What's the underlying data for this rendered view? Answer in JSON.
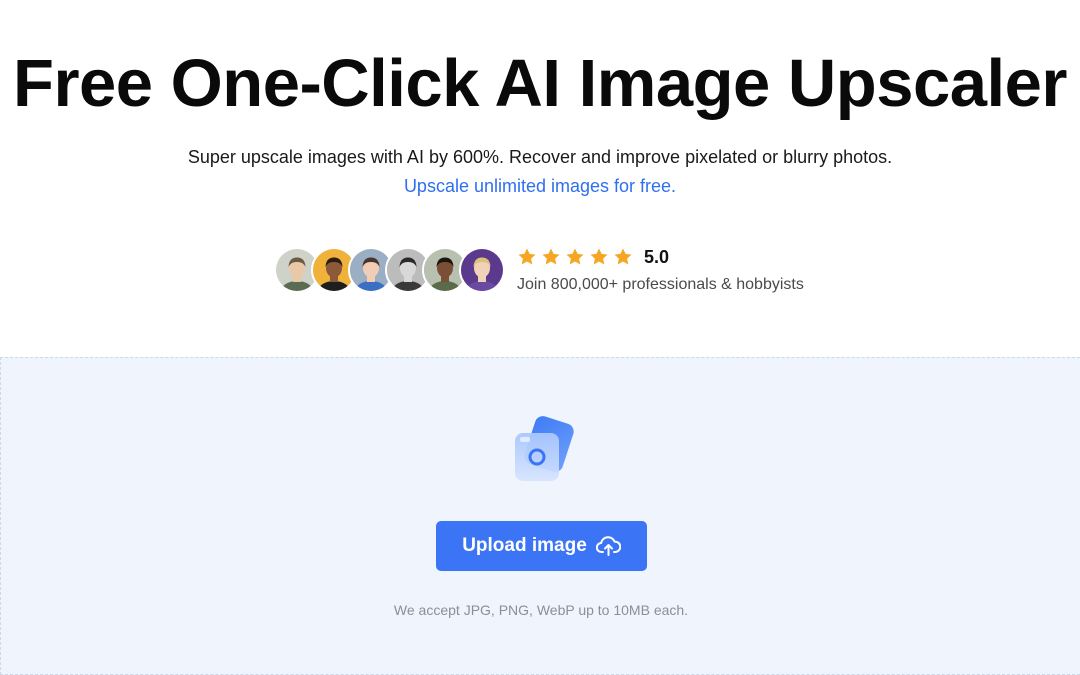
{
  "hero": {
    "title": "Free One-Click AI Image Upscaler",
    "subtitle": "Super upscale images with AI by 600%. Recover and improve pixelated or blurry photos.",
    "link": "Upscale unlimited images for free."
  },
  "social_proof": {
    "avatars": [
      {
        "name": "avatar-1",
        "bg": "#cfd2c8",
        "skin": "#e9c8a8",
        "hair": "#6b5a44",
        "shirt": "#5a6b53"
      },
      {
        "name": "avatar-2",
        "bg": "#f0b23a",
        "skin": "#8a5a3a",
        "hair": "#2b1d14",
        "shirt": "#1e1e1e"
      },
      {
        "name": "avatar-3",
        "bg": "#9aaec4",
        "skin": "#f0cdb4",
        "hair": "#4b3428",
        "shirt": "#3b6fc1"
      },
      {
        "name": "avatar-4",
        "bg": "#bcbcbc",
        "skin": "#d8d8d8",
        "hair": "#2a2a2a",
        "shirt": "#3a3a3a"
      },
      {
        "name": "avatar-5",
        "bg": "#b8c0b0",
        "skin": "#7a4f36",
        "hair": "#1f1612",
        "shirt": "#5a6b4a"
      },
      {
        "name": "avatar-6",
        "bg": "#5b3a8e",
        "skin": "#f1d2b8",
        "hair": "#d9c27a",
        "shirt": "#6a4aa0"
      }
    ],
    "stars": 5,
    "star_color": "#f5a623",
    "rating": "5.0",
    "caption": "Join 800,000+ professionals & hobbyists"
  },
  "upload": {
    "illustration_icon": "camera-photo-icon",
    "button_label": "Upload image",
    "button_icon": "cloud-upload-icon",
    "button_color": "#3b74f4",
    "note": "We accept JPG, PNG, WebP up to 10MB each."
  }
}
